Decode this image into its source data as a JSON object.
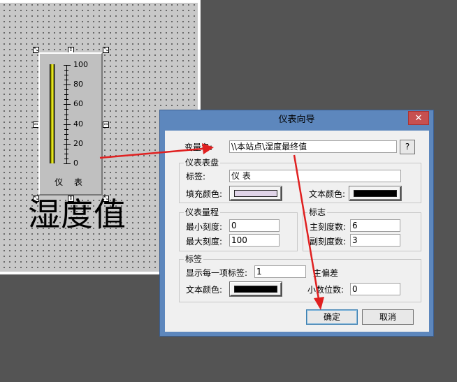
{
  "gauge": {
    "title": "仪 表",
    "ticks": [
      "100",
      "80",
      "60",
      "40",
      "20",
      "0"
    ],
    "fill_fraction": 1.0,
    "fill_color": "#e6e600"
  },
  "canvas_label": "湿度值",
  "handles": {
    "corner": "⤡",
    "side_v": "↕",
    "side_h": "↔"
  },
  "dialog": {
    "title": "仪表向导",
    "close_glyph": "✕",
    "variable": {
      "label": "变量名:",
      "value": "\\\\本站点\\湿度最终值",
      "help_label": "?"
    },
    "dial_group": {
      "title": "仪表表盘",
      "tag_label": "标签:",
      "tag_value": "仪 表",
      "fill_color_label": "填充颜色:",
      "fill_color": "#e0d4e8",
      "text_color_label": "文本颜色:",
      "text_color": "#000000"
    },
    "range_group": {
      "title": "仪表量程",
      "min_label": "最小刻度:",
      "min_value": "0",
      "max_label": "最大刻度:",
      "max_value": "100"
    },
    "mark_group": {
      "title": "标志",
      "major_label": "主刻度数:",
      "major_value": "6",
      "minor_label": "副刻度数:",
      "minor_value": "3"
    },
    "label_group": {
      "title": "标签",
      "every_label": "显示每一项标签:",
      "every_value": "1",
      "deviation_label": "主偏差",
      "text_color_label": "文本颜色:",
      "text_color": "#000000",
      "decimals_label": "小数位数:",
      "decimals_value": "0"
    },
    "ok_label": "确定",
    "cancel_label": "取消"
  },
  "annotation_color": "#e02020"
}
